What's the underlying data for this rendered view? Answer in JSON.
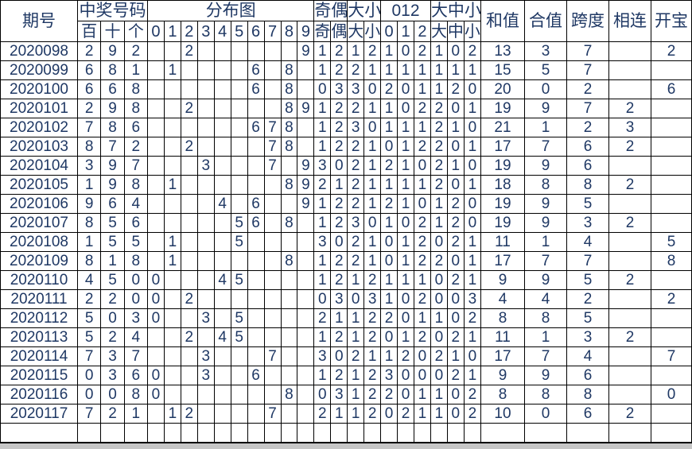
{
  "header": {
    "period": "期号",
    "winning_group": "中奖号码",
    "winning_subs": [
      "百",
      "十",
      "个"
    ],
    "dist_group": "分布图",
    "dist_subs": [
      "0",
      "1",
      "2",
      "3",
      "4",
      "5",
      "6",
      "7",
      "8",
      "9"
    ],
    "oddeven_group": "奇偶",
    "oddeven_subs": [
      "奇",
      "偶"
    ],
    "bigsmall_group": "大小",
    "bigsmall_subs": [
      "大",
      "小"
    ],
    "zeroonetwo_group": "012",
    "zeroonetwo_subs": [
      "0",
      "1",
      "2"
    ],
    "bigmidsmall_group": "大中小",
    "bigmidsmall_subs": [
      "大",
      "中",
      "小"
    ],
    "sum_label": "和值",
    "combo_label": "合值",
    "span_label": "跨度",
    "consecutive_label": "相连",
    "open_label": "开宝"
  },
  "colors": {
    "hit": "#0000ee",
    "repeat": "#fb0006",
    "header_bg": "#eaf2fb",
    "text": "#1f3864",
    "border": "#000000"
  },
  "rows": [
    {
      "period": "2020098",
      "digits": [
        "2",
        "9",
        "2"
      ],
      "dist": [
        " ",
        " ",
        "2",
        " ",
        " ",
        " ",
        " ",
        " ",
        " ",
        "9"
      ],
      "distState": [
        "",
        "",
        "rep",
        "",
        "",
        "",
        "",
        "",
        "",
        "hit"
      ],
      "oddeven": [
        "1",
        "2"
      ],
      "bigsmall": [
        "1",
        "2"
      ],
      "zot": [
        "1",
        "0",
        "2"
      ],
      "bms": [
        "1",
        "0",
        "2"
      ],
      "sum": "13",
      "combo": "3",
      "span": "7",
      "consec": "",
      "open": "2"
    },
    {
      "period": "2020099",
      "digits": [
        "6",
        "8",
        "1"
      ],
      "dist": [
        " ",
        "1",
        " ",
        " ",
        " ",
        " ",
        "6",
        " ",
        "8",
        " "
      ],
      "distState": [
        "",
        "hit",
        "",
        "",
        "",
        "",
        "hit",
        "",
        "hit",
        ""
      ],
      "oddeven": [
        "1",
        "2"
      ],
      "bigsmall": [
        "2",
        "1"
      ],
      "zot": [
        "1",
        "1",
        "1"
      ],
      "bms": [
        "1",
        "1",
        "1"
      ],
      "sum": "15",
      "combo": "5",
      "span": "7",
      "consec": "",
      "open": ""
    },
    {
      "period": "2020100",
      "digits": [
        "6",
        "6",
        "8"
      ],
      "dist": [
        " ",
        " ",
        " ",
        " ",
        " ",
        " ",
        "6",
        " ",
        "8",
        " "
      ],
      "distState": [
        "",
        "",
        "",
        "",
        "",
        "",
        "rep",
        "",
        "hit",
        ""
      ],
      "oddeven": [
        "0",
        "3"
      ],
      "bigsmall": [
        "3",
        "0"
      ],
      "zot": [
        "2",
        "0",
        "1"
      ],
      "bms": [
        "1",
        "2",
        "0"
      ],
      "sum": "20",
      "combo": "0",
      "span": "2",
      "consec": "",
      "open": "6"
    },
    {
      "period": "2020101",
      "digits": [
        "2",
        "9",
        "8"
      ],
      "dist": [
        " ",
        " ",
        "2",
        " ",
        " ",
        " ",
        " ",
        " ",
        "8",
        "9"
      ],
      "distState": [
        "",
        "",
        "hit",
        "",
        "",
        "",
        "",
        "",
        "hit",
        "hit"
      ],
      "oddeven": [
        "1",
        "2"
      ],
      "bigsmall": [
        "2",
        "1"
      ],
      "zot": [
        "1",
        "0",
        "2"
      ],
      "bms": [
        "2",
        "0",
        "1"
      ],
      "sum": "19",
      "combo": "9",
      "span": "7",
      "consec": "2",
      "open": ""
    },
    {
      "period": "2020102",
      "digits": [
        "7",
        "8",
        "6"
      ],
      "dist": [
        " ",
        " ",
        " ",
        " ",
        " ",
        " ",
        "6",
        "7",
        "8",
        " "
      ],
      "distState": [
        "",
        "",
        "",
        "",
        "",
        "",
        "hit",
        "hit",
        "hit",
        ""
      ],
      "oddeven": [
        "1",
        "2"
      ],
      "bigsmall": [
        "3",
        "0"
      ],
      "zot": [
        "1",
        "1",
        "1"
      ],
      "bms": [
        "2",
        "1",
        "0"
      ],
      "sum": "21",
      "combo": "1",
      "span": "2",
      "consec": "3",
      "open": ""
    },
    {
      "period": "2020103",
      "digits": [
        "8",
        "7",
        "2"
      ],
      "dist": [
        " ",
        " ",
        "2",
        " ",
        " ",
        " ",
        " ",
        "7",
        "8",
        " "
      ],
      "distState": [
        "",
        "",
        "hit",
        "",
        "",
        "",
        "",
        "hit",
        "hit",
        ""
      ],
      "oddeven": [
        "1",
        "2"
      ],
      "bigsmall": [
        "2",
        "1"
      ],
      "zot": [
        "0",
        "1",
        "2"
      ],
      "bms": [
        "2",
        "0",
        "1"
      ],
      "sum": "17",
      "combo": "7",
      "span": "6",
      "consec": "2",
      "open": ""
    },
    {
      "period": "2020104",
      "digits": [
        "3",
        "9",
        "7"
      ],
      "dist": [
        " ",
        " ",
        " ",
        "3",
        " ",
        " ",
        " ",
        "7",
        " ",
        "9"
      ],
      "distState": [
        "",
        "",
        "",
        "hit",
        "",
        "",
        "",
        "hit",
        "",
        "hit"
      ],
      "oddeven": [
        "3",
        "0"
      ],
      "bigsmall": [
        "2",
        "1"
      ],
      "zot": [
        "2",
        "1",
        "0"
      ],
      "bms": [
        "2",
        "1",
        "0"
      ],
      "sum": "19",
      "combo": "9",
      "span": "6",
      "consec": "",
      "open": ""
    },
    {
      "period": "2020105",
      "digits": [
        "1",
        "9",
        "8"
      ],
      "dist": [
        " ",
        "1",
        " ",
        " ",
        " ",
        " ",
        " ",
        " ",
        "8",
        "9"
      ],
      "distState": [
        "",
        "hit",
        "",
        "",
        "",
        "",
        "",
        "",
        "hit",
        "hit"
      ],
      "oddeven": [
        "2",
        "1"
      ],
      "bigsmall": [
        "2",
        "1"
      ],
      "zot": [
        "1",
        "1",
        "1"
      ],
      "bms": [
        "2",
        "0",
        "1"
      ],
      "sum": "18",
      "combo": "8",
      "span": "8",
      "consec": "2",
      "open": ""
    },
    {
      "period": "2020106",
      "digits": [
        "9",
        "6",
        "4"
      ],
      "dist": [
        " ",
        " ",
        " ",
        " ",
        "4",
        " ",
        "6",
        " ",
        " ",
        "9"
      ],
      "distState": [
        "",
        "",
        "",
        "",
        "hit",
        "",
        "hit",
        "",
        "",
        "hit"
      ],
      "oddeven": [
        "1",
        "2"
      ],
      "bigsmall": [
        "2",
        "1"
      ],
      "zot": [
        "2",
        "1",
        "0"
      ],
      "bms": [
        "1",
        "2",
        "0"
      ],
      "sum": "19",
      "combo": "9",
      "span": "5",
      "consec": "",
      "open": ""
    },
    {
      "period": "2020107",
      "digits": [
        "8",
        "5",
        "6"
      ],
      "dist": [
        " ",
        " ",
        " ",
        " ",
        " ",
        "5",
        "6",
        " ",
        "8",
        " "
      ],
      "distState": [
        "",
        "",
        "",
        "",
        "",
        "hit",
        "hit",
        "",
        "hit",
        ""
      ],
      "oddeven": [
        "1",
        "2"
      ],
      "bigsmall": [
        "3",
        "0"
      ],
      "zot": [
        "1",
        "0",
        "2"
      ],
      "bms": [
        "1",
        "2",
        "0"
      ],
      "sum": "19",
      "combo": "9",
      "span": "3",
      "consec": "2",
      "open": ""
    },
    {
      "period": "2020108",
      "digits": [
        "1",
        "5",
        "5"
      ],
      "dist": [
        " ",
        "1",
        " ",
        " ",
        " ",
        "5",
        " ",
        " ",
        " ",
        " "
      ],
      "distState": [
        "",
        "hit",
        "",
        "",
        "",
        "rep",
        "",
        "",
        "",
        ""
      ],
      "oddeven": [
        "3",
        "0"
      ],
      "bigsmall": [
        "2",
        "1"
      ],
      "zot": [
        "0",
        "1",
        "2"
      ],
      "bms": [
        "0",
        "2",
        "1"
      ],
      "sum": "11",
      "combo": "1",
      "span": "4",
      "consec": "",
      "open": "5"
    },
    {
      "period": "2020109",
      "digits": [
        "8",
        "1",
        "8"
      ],
      "dist": [
        " ",
        "1",
        " ",
        " ",
        " ",
        " ",
        " ",
        " ",
        "8",
        " "
      ],
      "distState": [
        "",
        "hit",
        "",
        "",
        "",
        "",
        "",
        "",
        "rep",
        ""
      ],
      "oddeven": [
        "1",
        "2"
      ],
      "bigsmall": [
        "2",
        "1"
      ],
      "zot": [
        "0",
        "1",
        "2"
      ],
      "bms": [
        "2",
        "0",
        "1"
      ],
      "sum": "17",
      "combo": "7",
      "span": "7",
      "consec": "",
      "open": "8"
    },
    {
      "period": "2020110",
      "digits": [
        "4",
        "5",
        "0"
      ],
      "dist": [
        "0",
        " ",
        " ",
        " ",
        "4",
        "5",
        " ",
        " ",
        " ",
        " "
      ],
      "distState": [
        "hit",
        "",
        "",
        "",
        "hit",
        "hit",
        "",
        "",
        "",
        ""
      ],
      "oddeven": [
        "1",
        "2"
      ],
      "bigsmall": [
        "1",
        "2"
      ],
      "zot": [
        "1",
        "1",
        "1"
      ],
      "bms": [
        "0",
        "2",
        "1"
      ],
      "sum": "9",
      "combo": "9",
      "span": "5",
      "consec": "2",
      "open": ""
    },
    {
      "period": "2020111",
      "digits": [
        "2",
        "2",
        "0"
      ],
      "dist": [
        "0",
        " ",
        "2",
        " ",
        " ",
        " ",
        " ",
        " ",
        " ",
        " "
      ],
      "distState": [
        "hit",
        "",
        "rep",
        "",
        "",
        "",
        "",
        "",
        "",
        ""
      ],
      "oddeven": [
        "0",
        "3"
      ],
      "bigsmall": [
        "0",
        "3"
      ],
      "zot": [
        "1",
        "0",
        "2"
      ],
      "bms": [
        "0",
        "0",
        "3"
      ],
      "sum": "4",
      "combo": "4",
      "span": "2",
      "consec": "",
      "open": "2"
    },
    {
      "period": "2020112",
      "digits": [
        "5",
        "0",
        "3"
      ],
      "dist": [
        "0",
        " ",
        " ",
        "3",
        " ",
        "5",
        " ",
        " ",
        " ",
        " "
      ],
      "distState": [
        "hit",
        "",
        "",
        "hit",
        "",
        "hit",
        "",
        "",
        "",
        ""
      ],
      "oddeven": [
        "2",
        "1"
      ],
      "bigsmall": [
        "1",
        "2"
      ],
      "zot": [
        "2",
        "0",
        "1"
      ],
      "bms": [
        "1",
        "0",
        "2"
      ],
      "sum": "8",
      "combo": "8",
      "span": "5",
      "consec": "",
      "open": ""
    },
    {
      "period": "2020113",
      "digits": [
        "5",
        "2",
        "4"
      ],
      "dist": [
        " ",
        " ",
        "2",
        " ",
        "4",
        "5",
        " ",
        " ",
        " ",
        " "
      ],
      "distState": [
        "",
        "",
        "hit",
        "",
        "hit",
        "hit",
        "",
        "",
        "",
        ""
      ],
      "oddeven": [
        "1",
        "2"
      ],
      "bigsmall": [
        "1",
        "2"
      ],
      "zot": [
        "0",
        "1",
        "2"
      ],
      "bms": [
        "0",
        "2",
        "1"
      ],
      "sum": "11",
      "combo": "1",
      "span": "3",
      "consec": "2",
      "open": ""
    },
    {
      "period": "2020114",
      "digits": [
        "7",
        "3",
        "7"
      ],
      "dist": [
        " ",
        " ",
        " ",
        "3",
        " ",
        " ",
        " ",
        "7",
        " ",
        " "
      ],
      "distState": [
        "",
        "",
        "",
        "hit",
        "",
        "",
        "",
        "rep",
        "",
        ""
      ],
      "oddeven": [
        "3",
        "0"
      ],
      "bigsmall": [
        "2",
        "1"
      ],
      "zot": [
        "1",
        "2",
        "0"
      ],
      "bms": [
        "2",
        "1",
        "0"
      ],
      "sum": "17",
      "combo": "7",
      "span": "4",
      "consec": "",
      "open": "7"
    },
    {
      "period": "2020115",
      "digits": [
        "0",
        "3",
        "6"
      ],
      "dist": [
        "0",
        " ",
        " ",
        "3",
        " ",
        " ",
        "6",
        " ",
        " ",
        " "
      ],
      "distState": [
        "hit",
        "",
        "",
        "hit",
        "",
        "",
        "hit",
        "",
        "",
        ""
      ],
      "oddeven": [
        "1",
        "2"
      ],
      "bigsmall": [
        "1",
        "2"
      ],
      "zot": [
        "3",
        "0",
        "0"
      ],
      "bms": [
        "0",
        "2",
        "1"
      ],
      "sum": "9",
      "combo": "9",
      "span": "6",
      "consec": "",
      "open": ""
    },
    {
      "period": "2020116",
      "digits": [
        "0",
        "0",
        "8"
      ],
      "dist": [
        "0",
        " ",
        " ",
        " ",
        " ",
        " ",
        " ",
        " ",
        "8",
        " "
      ],
      "distState": [
        "rep",
        "",
        "",
        "",
        "",
        "",
        "",
        "",
        "hit",
        ""
      ],
      "oddeven": [
        "0",
        "3"
      ],
      "bigsmall": [
        "1",
        "2"
      ],
      "zot": [
        "2",
        "0",
        "1"
      ],
      "bms": [
        "1",
        "0",
        "2"
      ],
      "sum": "8",
      "combo": "8",
      "span": "8",
      "consec": "",
      "open": "0"
    },
    {
      "period": "2020117",
      "digits": [
        "7",
        "2",
        "1"
      ],
      "dist": [
        " ",
        "1",
        "2",
        " ",
        " ",
        " ",
        " ",
        "7",
        " ",
        " "
      ],
      "distState": [
        "",
        "hit",
        "hit",
        "",
        "",
        "",
        "",
        "hit",
        "",
        ""
      ],
      "oddeven": [
        "2",
        "1"
      ],
      "bigsmall": [
        "1",
        "2"
      ],
      "zot": [
        "0",
        "2",
        "1"
      ],
      "bms": [
        "1",
        "0",
        "2"
      ],
      "sum": "10",
      "combo": "0",
      "span": "6",
      "consec": "2",
      "open": ""
    }
  ]
}
